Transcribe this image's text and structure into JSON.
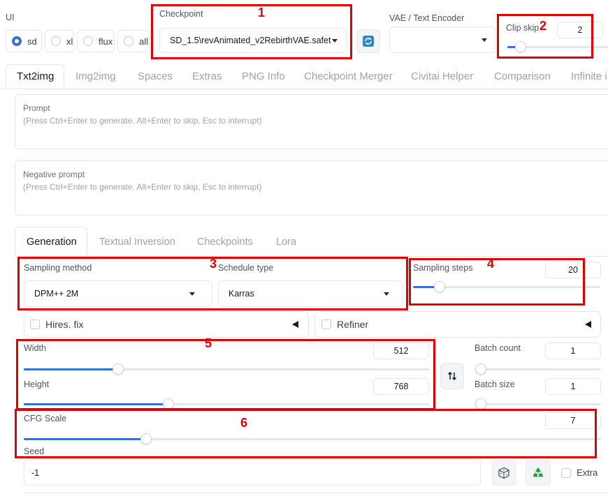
{
  "ui_selector": {
    "label": "UI",
    "options": [
      "sd",
      "xl",
      "flux",
      "all"
    ],
    "selected": "sd"
  },
  "checkpoint": {
    "label": "Checkpoint",
    "value": "SD_1.5\\revAnimated_v2RebirthVAE.safet"
  },
  "vae": {
    "label": "VAE / Text Encoder",
    "value": ""
  },
  "clip_skip": {
    "label": "Clip skip",
    "value": "2",
    "level": 0.1
  },
  "tabs": [
    "Txt2img",
    "Img2img",
    "Spaces",
    "Extras",
    "PNG Info",
    "Checkpoint Merger",
    "Civitai Helper",
    "Comparison",
    "Infinite i"
  ],
  "active_tab": "Txt2img",
  "prompt": {
    "label": "Prompt",
    "placeholder": "(Press Ctrl+Enter to generate, Alt+Enter to skip, Esc to interrupt)"
  },
  "negative_prompt": {
    "label": "Negative prompt",
    "placeholder": "(Press Ctrl+Enter to generate, Alt+Enter to skip, Esc to interrupt)"
  },
  "subtabs": [
    "Generation",
    "Textual Inversion",
    "Checkpoints",
    "Lora"
  ],
  "active_subtab": "Generation",
  "sampling_method": {
    "label": "Sampling method",
    "value": "DPM++ 2M"
  },
  "schedule_type": {
    "label": "Schedule type",
    "value": "Karras"
  },
  "sampling_steps": {
    "label": "Sampling steps",
    "value": "20",
    "min": 1,
    "max": 150
  },
  "hires_fix": {
    "label": "Hires. fix"
  },
  "refiner": {
    "label": "Refiner"
  },
  "width": {
    "label": "Width",
    "value": "512",
    "min": 64,
    "max": 2048
  },
  "height": {
    "label": "Height",
    "value": "768",
    "min": 64,
    "max": 2048
  },
  "batch_count": {
    "label": "Batch count",
    "value": "1"
  },
  "batch_size": {
    "label": "Batch size",
    "value": "1"
  },
  "swap_icon": "swap-vertical-arrows",
  "cfg_scale": {
    "label": "CFG Scale",
    "value": "7",
    "min": 1,
    "max": 30
  },
  "seed": {
    "label": "Seed",
    "value": "-1"
  },
  "extra": {
    "label": "Extra"
  },
  "annotations": [
    "1",
    "2",
    "3",
    "4",
    "5",
    "6"
  ],
  "colors": {
    "accent": "#3b6fd8",
    "annotation": "#e00000",
    "recycle": "#1e9e3c"
  }
}
